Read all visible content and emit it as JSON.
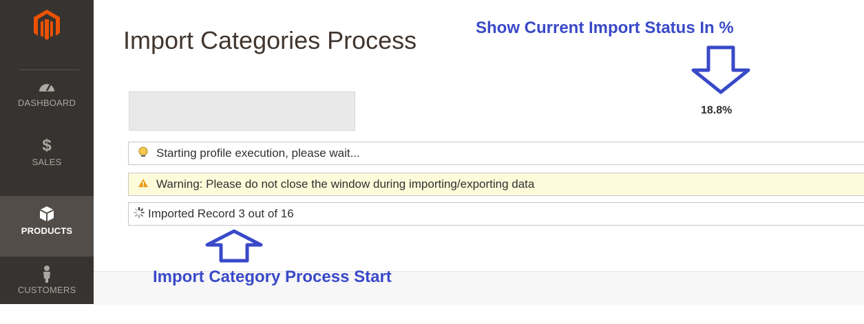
{
  "sidebar": {
    "logo": "magento-logo",
    "items": [
      {
        "label": "DASHBOARD",
        "icon": "speedometer-icon",
        "active": false
      },
      {
        "label": "SALES",
        "icon": "dollar-icon",
        "active": false
      },
      {
        "label": "PRODUCTS",
        "icon": "box-icon",
        "active": true
      },
      {
        "label": "CUSTOMERS",
        "icon": "person-icon",
        "active": false
      }
    ]
  },
  "page": {
    "title": "Import Categories Process"
  },
  "progress": {
    "percent_text": "18.8%",
    "fraction": 0.188
  },
  "messages": {
    "info": "Starting profile execution, please wait...",
    "warning": "Warning: Please do not close the window during importing/exporting data",
    "status": "Imported Record 3 out of 16"
  },
  "annotations": {
    "top": "Show Current Import Status In %",
    "bottom": "Import Category Process Start",
    "color": "#3949c8"
  },
  "colors": {
    "sidebar": "#373330",
    "sidebar_active": "#524d49",
    "logo": "#eb5202",
    "warning_bg": "#fdfbd9"
  }
}
